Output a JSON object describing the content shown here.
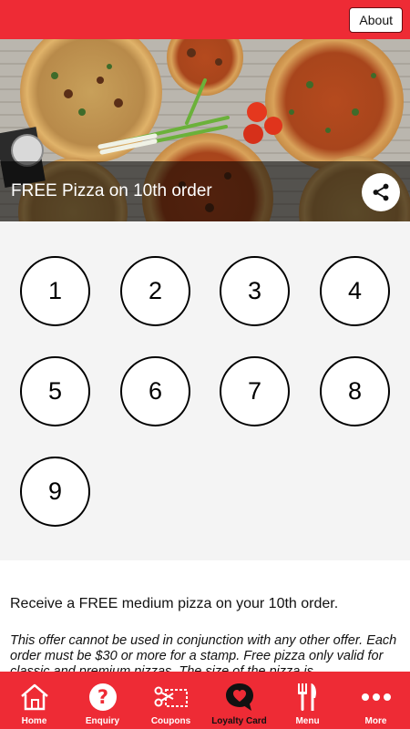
{
  "topbar": {
    "about_label": "About"
  },
  "hero": {
    "title": "FREE Pizza on 10th order"
  },
  "stamps": [
    "1",
    "2",
    "3",
    "4",
    "5",
    "6",
    "7",
    "8",
    "9"
  ],
  "description": {
    "main": "Receive a FREE medium pizza on your 10th order.",
    "terms": "This offer cannot be used in conjunction with any other offer. Each order must be $30 or more for a stamp. Free pizza only valid for classic and premium pizzas. The size of the pizza is"
  },
  "nav": {
    "items": [
      {
        "label": "Home",
        "icon": "home-icon"
      },
      {
        "label": "Enquiry",
        "icon": "question-icon"
      },
      {
        "label": "Coupons",
        "icon": "scissors-coupon-icon"
      },
      {
        "label": "Loyalty Card",
        "icon": "heart-chat-icon"
      },
      {
        "label": "Menu",
        "icon": "fork-knife-icon"
      },
      {
        "label": "More",
        "icon": "more-dots-icon"
      }
    ]
  },
  "colors": {
    "brand": "#ee2b35",
    "active_icon": "#111111"
  }
}
